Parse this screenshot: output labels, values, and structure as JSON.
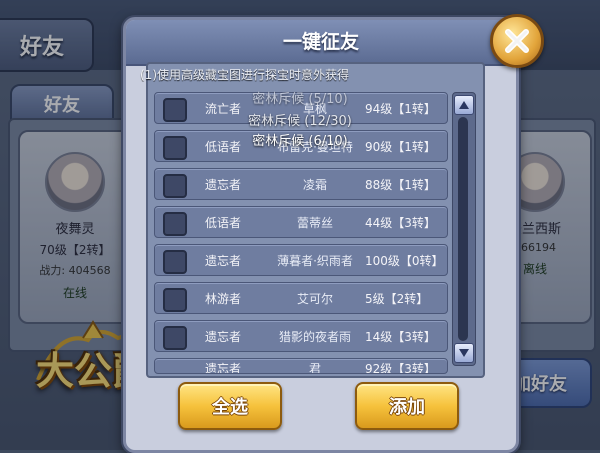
{
  "background": {
    "title": "好友",
    "tab": "好友",
    "add_button": "加好友",
    "logo": "大公爵",
    "friends": [
      {
        "name": "夜舞灵",
        "level": "70级【2转】",
        "power_label": "战力:",
        "power": "404568",
        "status": "在线"
      },
      {
        "name": "法兰西斯",
        "level": "",
        "power_label": "",
        "power": "166194",
        "status": "离线"
      }
    ]
  },
  "modal": {
    "title": "一键征友",
    "notice": "(1)使用高级藏宝图进行探宝时意外获得",
    "toasts": [
      "密林斥候 (5/10)",
      "密林斥候 (12/30)",
      "密林斥候 (6/10)"
    ],
    "rows": [
      {
        "type": "流亡者",
        "name": "草枫",
        "level": "94级【1转】"
      },
      {
        "type": "低语者",
        "name": "布雷克·曼坦特",
        "level": "90级【1转】"
      },
      {
        "type": "遗忘者",
        "name": "凌霜",
        "level": "88级【1转】"
      },
      {
        "type": "低语者",
        "name": "蕾蒂丝",
        "level": "44级【3转】"
      },
      {
        "type": "遗忘者",
        "name": "薄暮者·织雨者",
        "level": "100级【0转】"
      },
      {
        "type": "林游者",
        "name": "艾可尔",
        "level": "5级【2转】"
      },
      {
        "type": "遗忘者",
        "name": "猎影的夜者雨",
        "level": "14级【3转】"
      },
      {
        "type": "遗忘者",
        "name": "君",
        "level": "92级【3转】"
      }
    ],
    "select_all": "全选",
    "add": "添加"
  },
  "colors": {
    "header": "#6b7ba2",
    "gold": "#f6c23c",
    "row": "#6f7da0"
  }
}
